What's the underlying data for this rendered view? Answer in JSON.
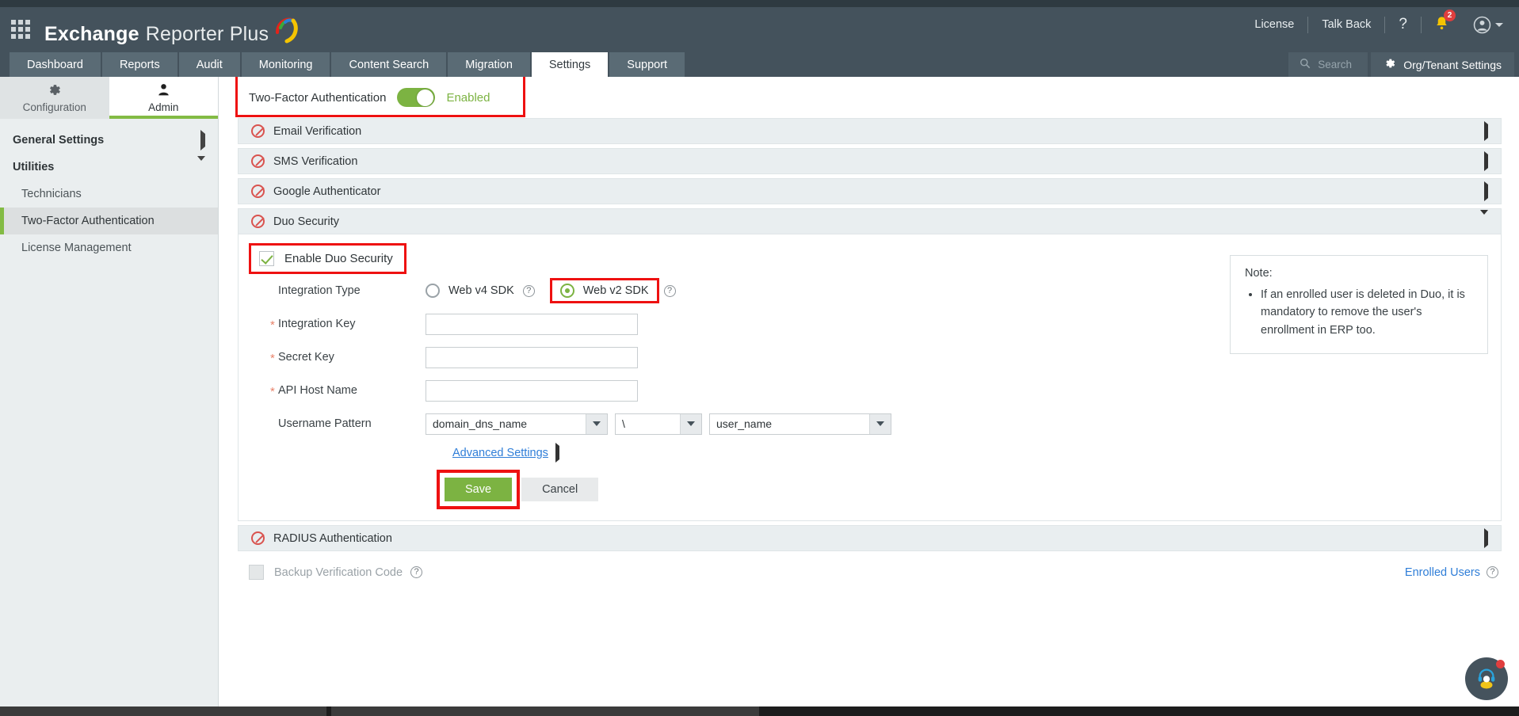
{
  "header": {
    "brand_bold": "Exchange",
    "brand_light": "Reporter Plus",
    "grid_icon": "app-grid-icon",
    "links": [
      "License",
      "Talk Back"
    ],
    "help_icon": "?",
    "notification_count": "2",
    "avatar_icon": "user-avatar-icon"
  },
  "tabs": [
    {
      "label": "Dashboard",
      "active": false
    },
    {
      "label": "Reports",
      "active": false
    },
    {
      "label": "Audit",
      "active": false
    },
    {
      "label": "Monitoring",
      "active": false
    },
    {
      "label": "Content Search",
      "active": false
    },
    {
      "label": "Migration",
      "active": false
    },
    {
      "label": "Settings",
      "active": true
    },
    {
      "label": "Support",
      "active": false
    }
  ],
  "search": {
    "placeholder": "Search",
    "icon": "search-icon"
  },
  "org_settings": {
    "label": "Org/Tenant Settings",
    "icon": "gear-icon"
  },
  "sidebar": {
    "subtabs": [
      {
        "label": "Configuration",
        "icon": "gear-icon",
        "active": false
      },
      {
        "label": "Admin",
        "icon": "admin-user-icon",
        "active": true
      }
    ],
    "groups": [
      {
        "label": "General Settings",
        "expanded": false
      },
      {
        "label": "Utilities",
        "expanded": true
      }
    ],
    "items": [
      {
        "label": "Technicians",
        "active": false
      },
      {
        "label": "Two-Factor Authentication",
        "active": true
      },
      {
        "label": "License Management",
        "active": false
      }
    ]
  },
  "tfa": {
    "label": "Two-Factor Authentication",
    "toggle_state": "on",
    "state_text": "Enabled"
  },
  "accordion": [
    {
      "title": "Email Verification",
      "icon": "disabled-circle-icon",
      "expanded": false,
      "chevron": "chevron-right-icon"
    },
    {
      "title": "SMS Verification",
      "icon": "disabled-circle-icon",
      "expanded": false,
      "chevron": "chevron-right-icon"
    },
    {
      "title": "Google Authenticator",
      "icon": "disabled-circle-icon",
      "expanded": false,
      "chevron": "chevron-right-icon"
    },
    {
      "title": "Duo Security",
      "icon": "disabled-circle-icon",
      "expanded": true,
      "chevron": "chevron-down-icon"
    },
    {
      "title": "RADIUS Authentication",
      "icon": "disabled-circle-icon",
      "expanded": false,
      "chevron": "chevron-right-icon"
    }
  ],
  "duo": {
    "enable_label": "Enable Duo Security",
    "enable_checked": true,
    "integration_type_label": "Integration Type",
    "options": [
      {
        "label": "Web v4 SDK",
        "selected": false
      },
      {
        "label": "Web v2 SDK",
        "selected": true
      }
    ],
    "fields": [
      {
        "label": "Integration Key",
        "required": true,
        "value": "",
        "placeholder": ""
      },
      {
        "label": "Secret Key",
        "required": true,
        "value": "",
        "placeholder": ""
      },
      {
        "label": "API Host Name",
        "required": true,
        "value": "",
        "placeholder": ""
      }
    ],
    "username_pattern_label": "Username Pattern",
    "username_pattern": [
      {
        "value": "domain_dns_name"
      },
      {
        "value": "\\"
      },
      {
        "value": "user_name"
      }
    ],
    "advanced_settings": "Advanced Settings",
    "save_label": "Save",
    "cancel_label": "Cancel"
  },
  "note": {
    "title": "Note:",
    "items": [
      "If an enrolled user is deleted in Duo, it is mandatory to remove the user's enrollment in ERP too."
    ]
  },
  "footer": {
    "backup_label": "Backup Verification Code",
    "backup_checked": false,
    "enrolled_users": "Enrolled Users"
  },
  "colors": {
    "header_bg": "#44525c",
    "accent_green": "#7cb342",
    "highlight_red": "#ee1111",
    "link_blue": "#2f7ed8"
  }
}
